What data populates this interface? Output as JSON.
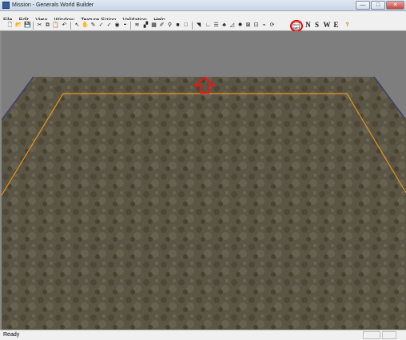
{
  "window": {
    "title": "Mission - Generals World Builder",
    "minimize_glyph": "—",
    "maximize_glyph": "□",
    "close_glyph": "✕"
  },
  "menu": [
    {
      "label": "File"
    },
    {
      "label": "Edit"
    },
    {
      "label": "View"
    },
    {
      "label": "Window"
    },
    {
      "label": "Texture Sizing"
    },
    {
      "label": "Validation"
    },
    {
      "label": "Help"
    }
  ],
  "toolbar": {
    "new_glyph": "🗋",
    "open_glyph": "📂",
    "save_glyph": "💾",
    "cut_glyph": "✂",
    "copy_glyph": "⧉",
    "paste_glyph": "📋",
    "undo_glyph": "↶",
    "pointer_glyph": "↖",
    "brush_glyph": "✎",
    "sun_label": "sun\ncam",
    "north": "N",
    "south": "S",
    "west": "W",
    "east": "E",
    "help_glyph": "?"
  },
  "status": {
    "text": "Ready"
  },
  "colors": {
    "terrain": "#5a5544",
    "boundary": "#e8951e",
    "arrow": "#e41818",
    "viewport_bg": "#7e7e7e"
  }
}
